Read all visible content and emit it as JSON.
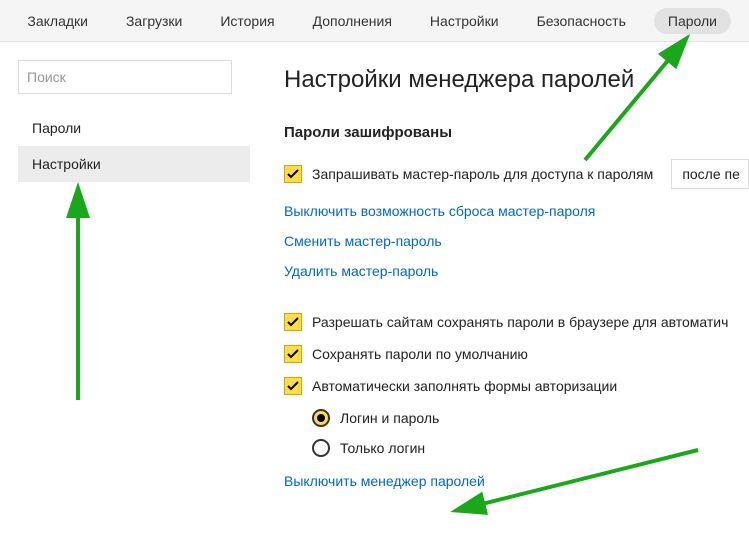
{
  "topbar": {
    "tabs": [
      {
        "label": "Закладки"
      },
      {
        "label": "Загрузки"
      },
      {
        "label": "История"
      },
      {
        "label": "Дополнения"
      },
      {
        "label": "Настройки"
      },
      {
        "label": "Безопасность"
      },
      {
        "label": "Пароли",
        "active": true
      }
    ]
  },
  "sidebar": {
    "search_placeholder": "Поиск",
    "items": [
      {
        "label": "Пароли"
      },
      {
        "label": "Настройки",
        "active": true
      }
    ]
  },
  "content": {
    "title": "Настройки менеджера паролей",
    "section1_heading": "Пароли зашифрованы",
    "checkbox_master": "Запрашивать мастер-пароль для доступа к паролям",
    "select_master_value": "после пе",
    "link_disable_reset": "Выключить возможность сброса мастер-пароля",
    "link_change_master": "Сменить мастер-пароль",
    "link_delete_master": "Удалить мастер-пароль",
    "checkbox_allow_save": "Разрешать сайтам сохранять пароли в браузере для автоматич",
    "checkbox_save_default": "Сохранять пароли по умолчанию",
    "checkbox_autofill": "Автоматически заполнять формы авторизации",
    "radio_login_password": "Логин и пароль",
    "radio_login_only": "Только логин",
    "link_disable_manager": "Выключить менеджер паролей"
  }
}
